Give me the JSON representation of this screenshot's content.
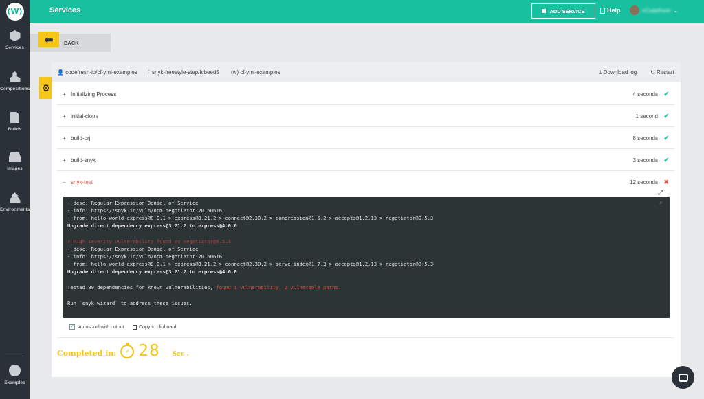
{
  "header": {
    "title": "Services",
    "add_service": "ADD SERVICE",
    "help": "Help",
    "username": "nCodefresh"
  },
  "sidebar": {
    "logo": "(W)",
    "items": [
      {
        "label": "Services",
        "icon": "cube-icon"
      },
      {
        "label": "Compositions",
        "icon": "cubes-icon"
      },
      {
        "label": "Builds",
        "icon": "document-icon"
      },
      {
        "label": "Images",
        "icon": "drive-icon"
      },
      {
        "label": "Environments",
        "icon": "upload-icon"
      },
      {
        "label": "Examples",
        "icon": "eye-icon"
      }
    ]
  },
  "back": {
    "label": "BACK"
  },
  "build": {
    "repo": "codefresh-io/cf-yml-examples",
    "branch": "snyk-freestyle-step/fcbeed5",
    "service": "cf-yml-examples",
    "download_log": "Download log",
    "restart": "Restart"
  },
  "steps": [
    {
      "sign": "+",
      "name": "Initializing Process",
      "duration": "4 seconds",
      "status": "✔"
    },
    {
      "sign": "+",
      "name": "initial-clone",
      "duration": "1 second",
      "status": "✔"
    },
    {
      "sign": "+",
      "name": "build-prj",
      "duration": "8 seconds",
      "status": "✔"
    },
    {
      "sign": "+",
      "name": "build-snyk",
      "duration": "3 seconds",
      "status": "✔"
    },
    {
      "sign": "−",
      "name": "snyk-test",
      "duration": "12 seconds",
      "status": "✖"
    }
  ],
  "terminal": {
    "lines": [
      "- desc: Regular Expression Denial of Service",
      "- info: https://snyk.io/vuln/npm:negotiator:20160616",
      "- from: hello-world-express@0.0.1 > express@3.21.2 > connect@2.30.2 > compression@1.5.2 > accepts@1.2.13 > negotiator@0.5.3",
      "Upgrade direct dependency express@3.21.2 to express@4.0.0",
      "✗ High severity vulnerability found on negotiator@0.5.3",
      "- desc: Regular Expression Denial of Service",
      "- info: https://snyk.io/vuln/npm:negotiator:20160616",
      "- from: hello-world-express@0.0.1 > express@3.21.2 > connect@2.30.2 > serve-index@1.7.3 > accepts@1.2.13 > negotiator@0.5.3",
      "Upgrade direct dependency express@3.21.2 to express@4.0.0",
      "Tested 89 dependencies for known vulnerabilities, ",
      "found 1 vulnerability, 2 vulnerable paths.",
      "Run `snyk wizard` to address these issues."
    ]
  },
  "autoscroll": "Autoscroll with output",
  "copy": "Copy to clipboard",
  "completed": {
    "label": "Completed in:",
    "value": "28",
    "unit": "Sec ."
  },
  "colors": {
    "header": "#19c0a0",
    "sidebar": "#2b3138",
    "accent": "#f5c518",
    "success": "#19b899",
    "error": "#e25a4e"
  }
}
